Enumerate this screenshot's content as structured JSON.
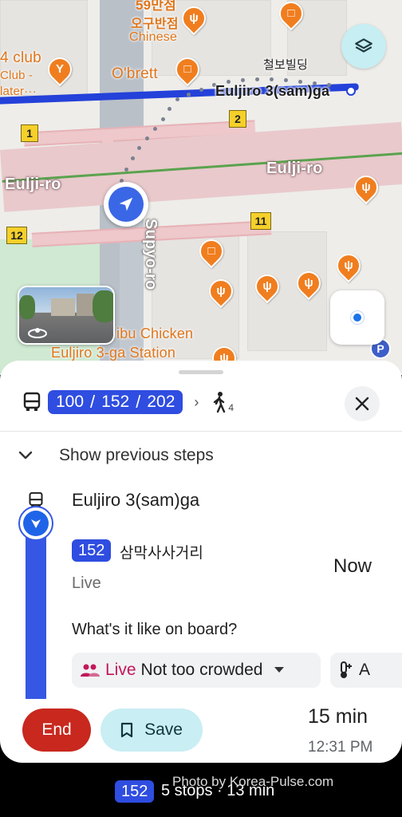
{
  "map": {
    "labels": {
      "restaurant_top": "59만점",
      "chinese_kr": "오구반점",
      "chinese_en": "Chinese",
      "club_name": "4 club",
      "club_sub1": "Club -",
      "club_sub2": "later···",
      "obrett": "O'brett",
      "building_kr": "철보빌딩",
      "station_top": "Euljiro 3(sam)ga",
      "eulji_left": "Eulji-ro",
      "eulji_right": "Eulji-ro",
      "supyo": "Supyo-ro",
      "chicken": "ibu Chicken",
      "station_bottom": "Euljiro 3-ga Station"
    },
    "shields": [
      "1",
      "2",
      "11",
      "12"
    ],
    "parking": "P",
    "icons": {
      "layers": "layers-icon",
      "my_location": "my-location-icon",
      "navigation": "navigation-arrow-icon"
    }
  },
  "sheet": {
    "routes": [
      "100",
      "152",
      "202"
    ],
    "walk_minutes": "4",
    "show_previous": "Show previous steps",
    "stop_name": "Euljiro 3(sam)ga",
    "route_number": "152",
    "route_destination": "삼막사사거리",
    "live_label": "Live",
    "arrival": "Now",
    "question": "What's it like on board?",
    "crowd_live": "Live",
    "crowd_status": "Not too crowded",
    "temp_chip": "A",
    "end_button": "End",
    "save_button": "Save",
    "duration": "15 min",
    "eta": "12:31 PM"
  },
  "bottom": {
    "route_number": "152",
    "summary": "5 stops · 13 min",
    "watermark": "Photo by Korea-Pulse.com"
  },
  "colors": {
    "route_blue": "#2f4de0",
    "end_red": "#c8281e",
    "save_teal": "#c9eef3",
    "live_pink": "#c2185b",
    "poi_orange": "#f07e1f"
  }
}
